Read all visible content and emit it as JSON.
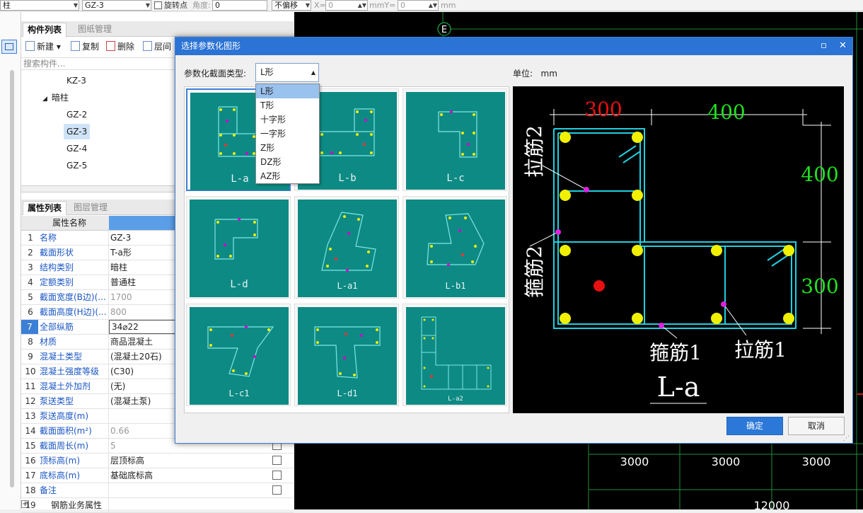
{
  "toolbar": {
    "type_value": "柱",
    "component_value": "GZ-3",
    "rotate_label": "旋转点",
    "angle_label": "角度:",
    "angle_value": "0",
    "offset_value": "不偏移",
    "x_label": "X=",
    "x_value": "0",
    "mm1": "mm",
    "y_label": "mmY=",
    "y_value": "0",
    "mm2": "mm"
  },
  "component_panel": {
    "tabs": [
      "构件列表",
      "图纸管理"
    ],
    "buttons": {
      "new": "新建",
      "copy": "复制",
      "delete": "删除",
      "floor": "层间"
    },
    "search_placeholder": "搜索构件...",
    "tree": {
      "kz3": "KZ-3",
      "group": "暗柱",
      "items": [
        "GZ-2",
        "GZ-3",
        "GZ-4",
        "GZ-5"
      ],
      "selected": "GZ-3"
    }
  },
  "property_panel": {
    "tabs": [
      "属性列表",
      "图层管理"
    ],
    "header_name": "属性名称",
    "header_value": "属",
    "rows": [
      {
        "num": "1",
        "name": "名称",
        "value": "GZ-3"
      },
      {
        "num": "2",
        "name": "截面形状",
        "value": "T-a形"
      },
      {
        "num": "3",
        "name": "结构类别",
        "value": "暗柱"
      },
      {
        "num": "4",
        "name": "定额类别",
        "value": "普通柱"
      },
      {
        "num": "5",
        "name": "截面宽度(B边)(...",
        "value": "1700"
      },
      {
        "num": "6",
        "name": "截面高度(H边)(...",
        "value": "800"
      },
      {
        "num": "7",
        "name": "全部纵筋",
        "value": "34⌀22"
      },
      {
        "num": "8",
        "name": "材质",
        "value": "商品混凝土"
      },
      {
        "num": "9",
        "name": "混凝土类型",
        "value": "(混凝土20石)"
      },
      {
        "num": "10",
        "name": "混凝土强度等级",
        "value": "(C30)"
      },
      {
        "num": "11",
        "name": "混凝土外加剂",
        "value": "(无)"
      },
      {
        "num": "12",
        "name": "泵送类型",
        "value": "(混凝土泵)"
      },
      {
        "num": "13",
        "name": "泵送高度(m)",
        "value": ""
      },
      {
        "num": "14",
        "name": "截面面积(m²)",
        "value": "0.66"
      },
      {
        "num": "15",
        "name": "截面周长(m)",
        "value": "5"
      },
      {
        "num": "16",
        "name": "顶标高(m)",
        "value": "层顶标高"
      },
      {
        "num": "17",
        "name": "底标高(m)",
        "value": "基础底标高"
      },
      {
        "num": "18",
        "name": "备注",
        "value": ""
      },
      {
        "num": "19",
        "name": "钢筋业务属性",
        "value": ""
      }
    ]
  },
  "cad": {
    "axis_label": "E",
    "dims": [
      "3000",
      "3000",
      "3000"
    ],
    "total_dim": "12000"
  },
  "dialog": {
    "title": "选择参数化图形",
    "type_label": "参数化截面类型:",
    "type_value": "L形",
    "unit_label": "单位:",
    "unit_value": "mm",
    "options": [
      "L形",
      "T形",
      "十字形",
      "一字形",
      "Z形",
      "DZ形",
      "AZ形"
    ],
    "thumbnails": [
      "L-a",
      "L-b",
      "L-c",
      "L-d",
      "L-a1",
      "L-b1",
      "L-c1",
      "L-d1",
      "L-a2"
    ],
    "preview": {
      "dim_top_left": "300",
      "dim_top_right": "400",
      "dim_right_top": "400",
      "dim_right_bottom": "300",
      "lajin2": "拉筋2",
      "gujin2": "箍筋2",
      "gujin1": "箍筋1",
      "lajin1": "拉筋1",
      "name": "L-a"
    },
    "ok_label": "确定",
    "cancel_label": "取消"
  }
}
